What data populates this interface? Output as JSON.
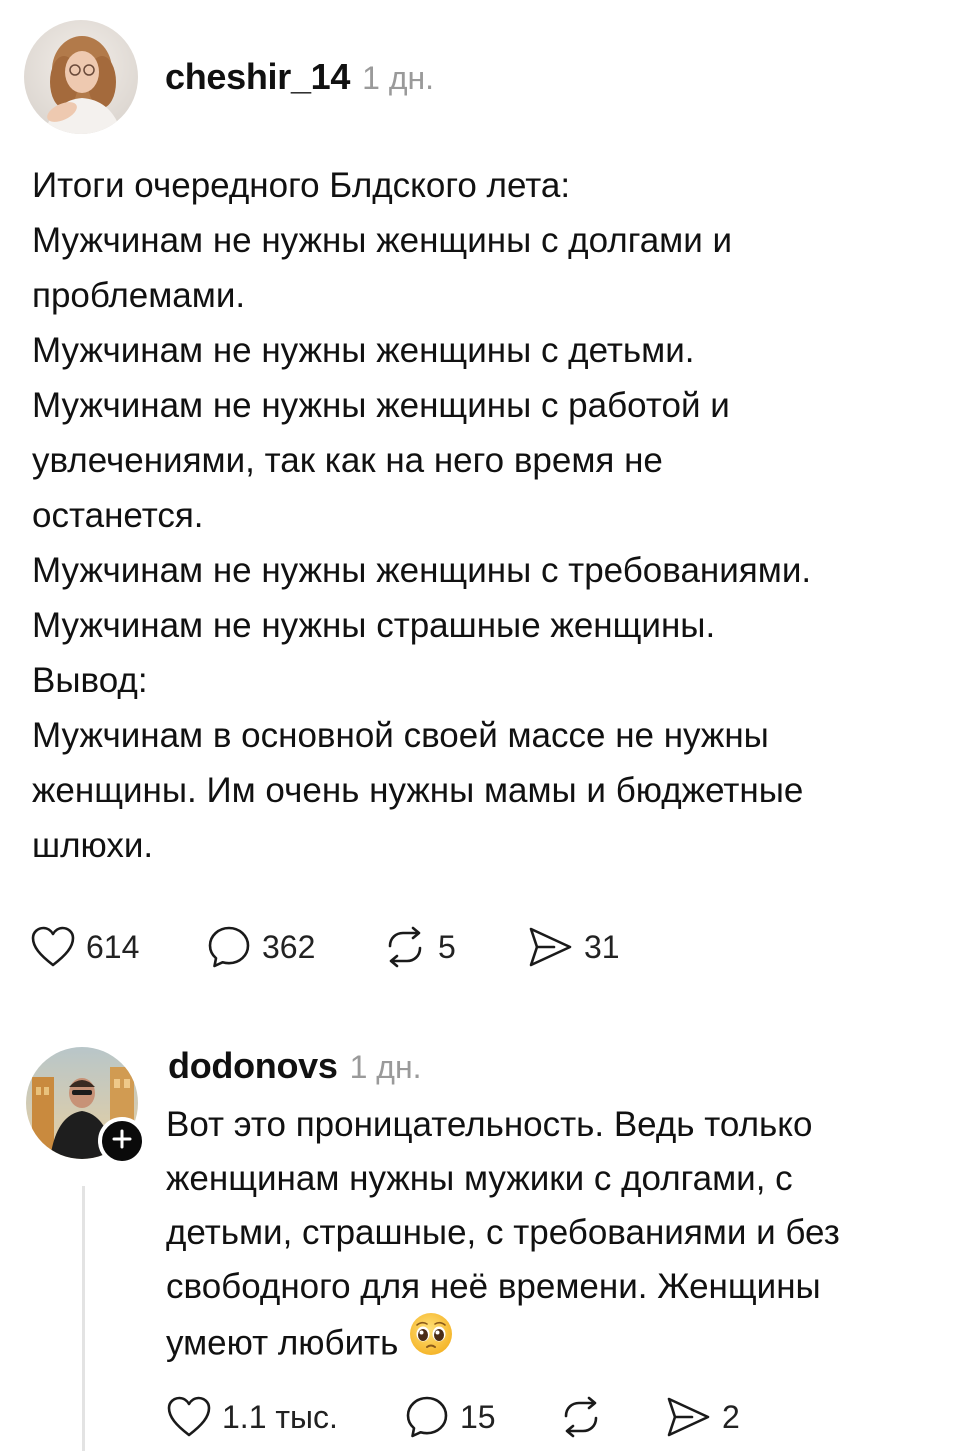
{
  "post": {
    "author": "cheshir_14",
    "time": "1 дн.",
    "lines": [
      "Итоги очередного Блдского лета:",
      "Мужчинам не нужны женщины с долгами и",
      "проблемами.",
      "Мужчинам не нужны женщины с детьми.",
      "Мужчинам не нужны женщины с работой и",
      "увлечениями, так как на него время не",
      "останется.",
      "Мужчинам не нужны женщины с требованиями.",
      "Мужчинам не нужны страшные женщины.",
      "Вывод:",
      "Мужчинам в основной своей массе не нужны",
      "женщины. Им очень нужны мамы и бюджетные",
      "шлюхи."
    ],
    "likes": "614",
    "comments": "362",
    "reposts": "5",
    "shares": "31"
  },
  "reply": {
    "author": "dodonovs",
    "time": "1 дн.",
    "lines": [
      "Вот это проницательность. Ведь только",
      "женщинам нужны мужики с долгами, с",
      "детьми, страшные, с требованиями и без",
      "свободного для неё времени. Женщины",
      "умеют любить"
    ],
    "emoji": "pleading-face-emoji",
    "likes": "1.1 тыс.",
    "comments": "15",
    "shares": "2"
  },
  "icons": {
    "like": "heart-icon",
    "comment": "speech-bubble-icon",
    "repost": "repost-arrows-icon",
    "share": "paper-plane-icon",
    "follow": "plus-icon"
  }
}
